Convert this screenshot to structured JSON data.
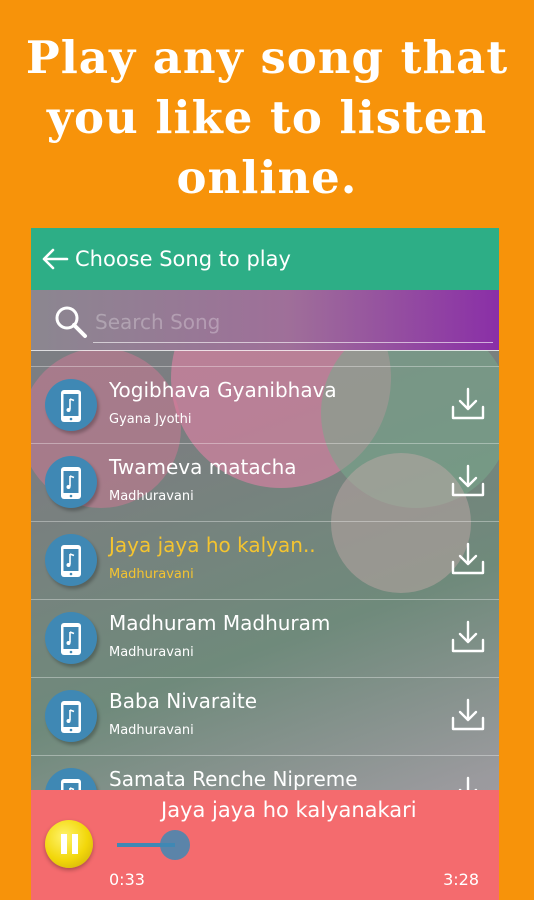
{
  "promo": {
    "line1": "Play any song that",
    "line2": "you like to listen",
    "line3": "online."
  },
  "appbar": {
    "title": "Choose Song to play",
    "back_icon": "arrow-left-icon"
  },
  "search": {
    "placeholder": "Search Song",
    "icon": "search-icon"
  },
  "songs": [
    {
      "title": "Yogibhava Gyanibhava",
      "artist": "Gyana Jyothi",
      "active": false
    },
    {
      "title": "Twameva matacha",
      "artist": "Madhuravani",
      "active": false
    },
    {
      "title": "Jaya jaya ho kalyan..",
      "artist": "Madhuravani",
      "active": true
    },
    {
      "title": "Madhuram Madhuram",
      "artist": "Madhuravani",
      "active": false
    },
    {
      "title": "Baba Nivaraite",
      "artist": "Madhuravani",
      "active": false
    },
    {
      "title": "Samata Renche Nipreme",
      "artist": "",
      "active": false
    }
  ],
  "player": {
    "now_playing": "Jaya jaya ho kalyanakari",
    "elapsed": "0:33",
    "duration": "3:28",
    "progress": 0.16
  },
  "colors": {
    "background": "#F7930A",
    "appbar": "#2DAE86",
    "player": "#F46B6E",
    "active_text": "#F4C430",
    "accent_blue": "#3F88B4"
  }
}
